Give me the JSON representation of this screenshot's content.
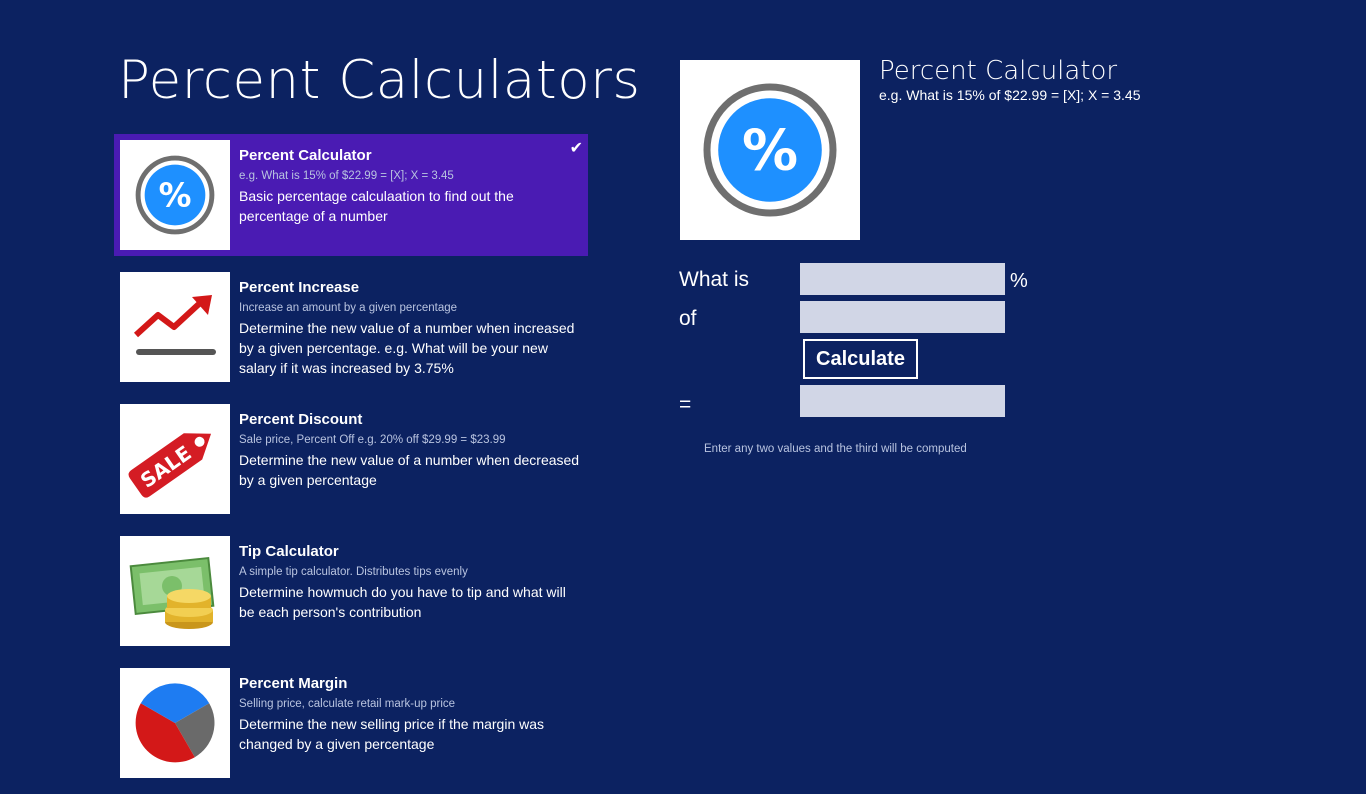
{
  "app": {
    "title": "Percent Calculators"
  },
  "list": {
    "items": [
      {
        "title": "Percent Calculator",
        "subtitle": "e.g. What is 15% of $22.99 = [X]; X = 3.45",
        "description": "Basic percentage calculaation to find out the percentage of a number",
        "icon": "percent-icon",
        "selected": true
      },
      {
        "title": "Percent Increase",
        "subtitle": "Increase an amount by a given percentage",
        "description": "Determine the new value of a number when increased by a given percentage. e.g. What will be your new salary if it was increased by 3.75%",
        "icon": "trend-up-icon"
      },
      {
        "title": "Percent Discount",
        "subtitle": "Sale price, Percent Off e.g. 20% off $29.99 = $23.99",
        "description": "Determine the new value of a number when decreased by a given percentage",
        "icon": "sale-tag-icon",
        "icon_text": "SALE"
      },
      {
        "title": "Tip Calculator",
        "subtitle": "A simple tip calculator. Distributes tips evenly",
        "description": "Determine howmuch do you have to tip and what will be each person's contribution",
        "icon": "money-coins-icon"
      },
      {
        "title": "Percent Margin",
        "subtitle": "Selling price, calculate retail mark-up price",
        "description": "Determine the new selling price if the margin was changed by a given percentage",
        "icon": "pie-chart-icon"
      }
    ]
  },
  "detail": {
    "title": "Percent Calculator",
    "subtitle": "e.g. What is 15% of $22.99 = [X]; X = 3.45",
    "image_icon": "percent-icon"
  },
  "form": {
    "what_is_label": "What is",
    "of_label": "of",
    "percent_symbol": "%",
    "equals_label": "=",
    "calculate_label": "Calculate",
    "hint": "Enter any two values and the third will be computed",
    "percent_value": "",
    "number_value": "",
    "result_value": ""
  },
  "colors": {
    "background": "#0c2261",
    "selected": "#4a1bb3",
    "field": "#d1d6e6",
    "percent_icon_blue": "#1e90ff",
    "trend_red": "#d31818",
    "sale_red": "#d41c24"
  }
}
